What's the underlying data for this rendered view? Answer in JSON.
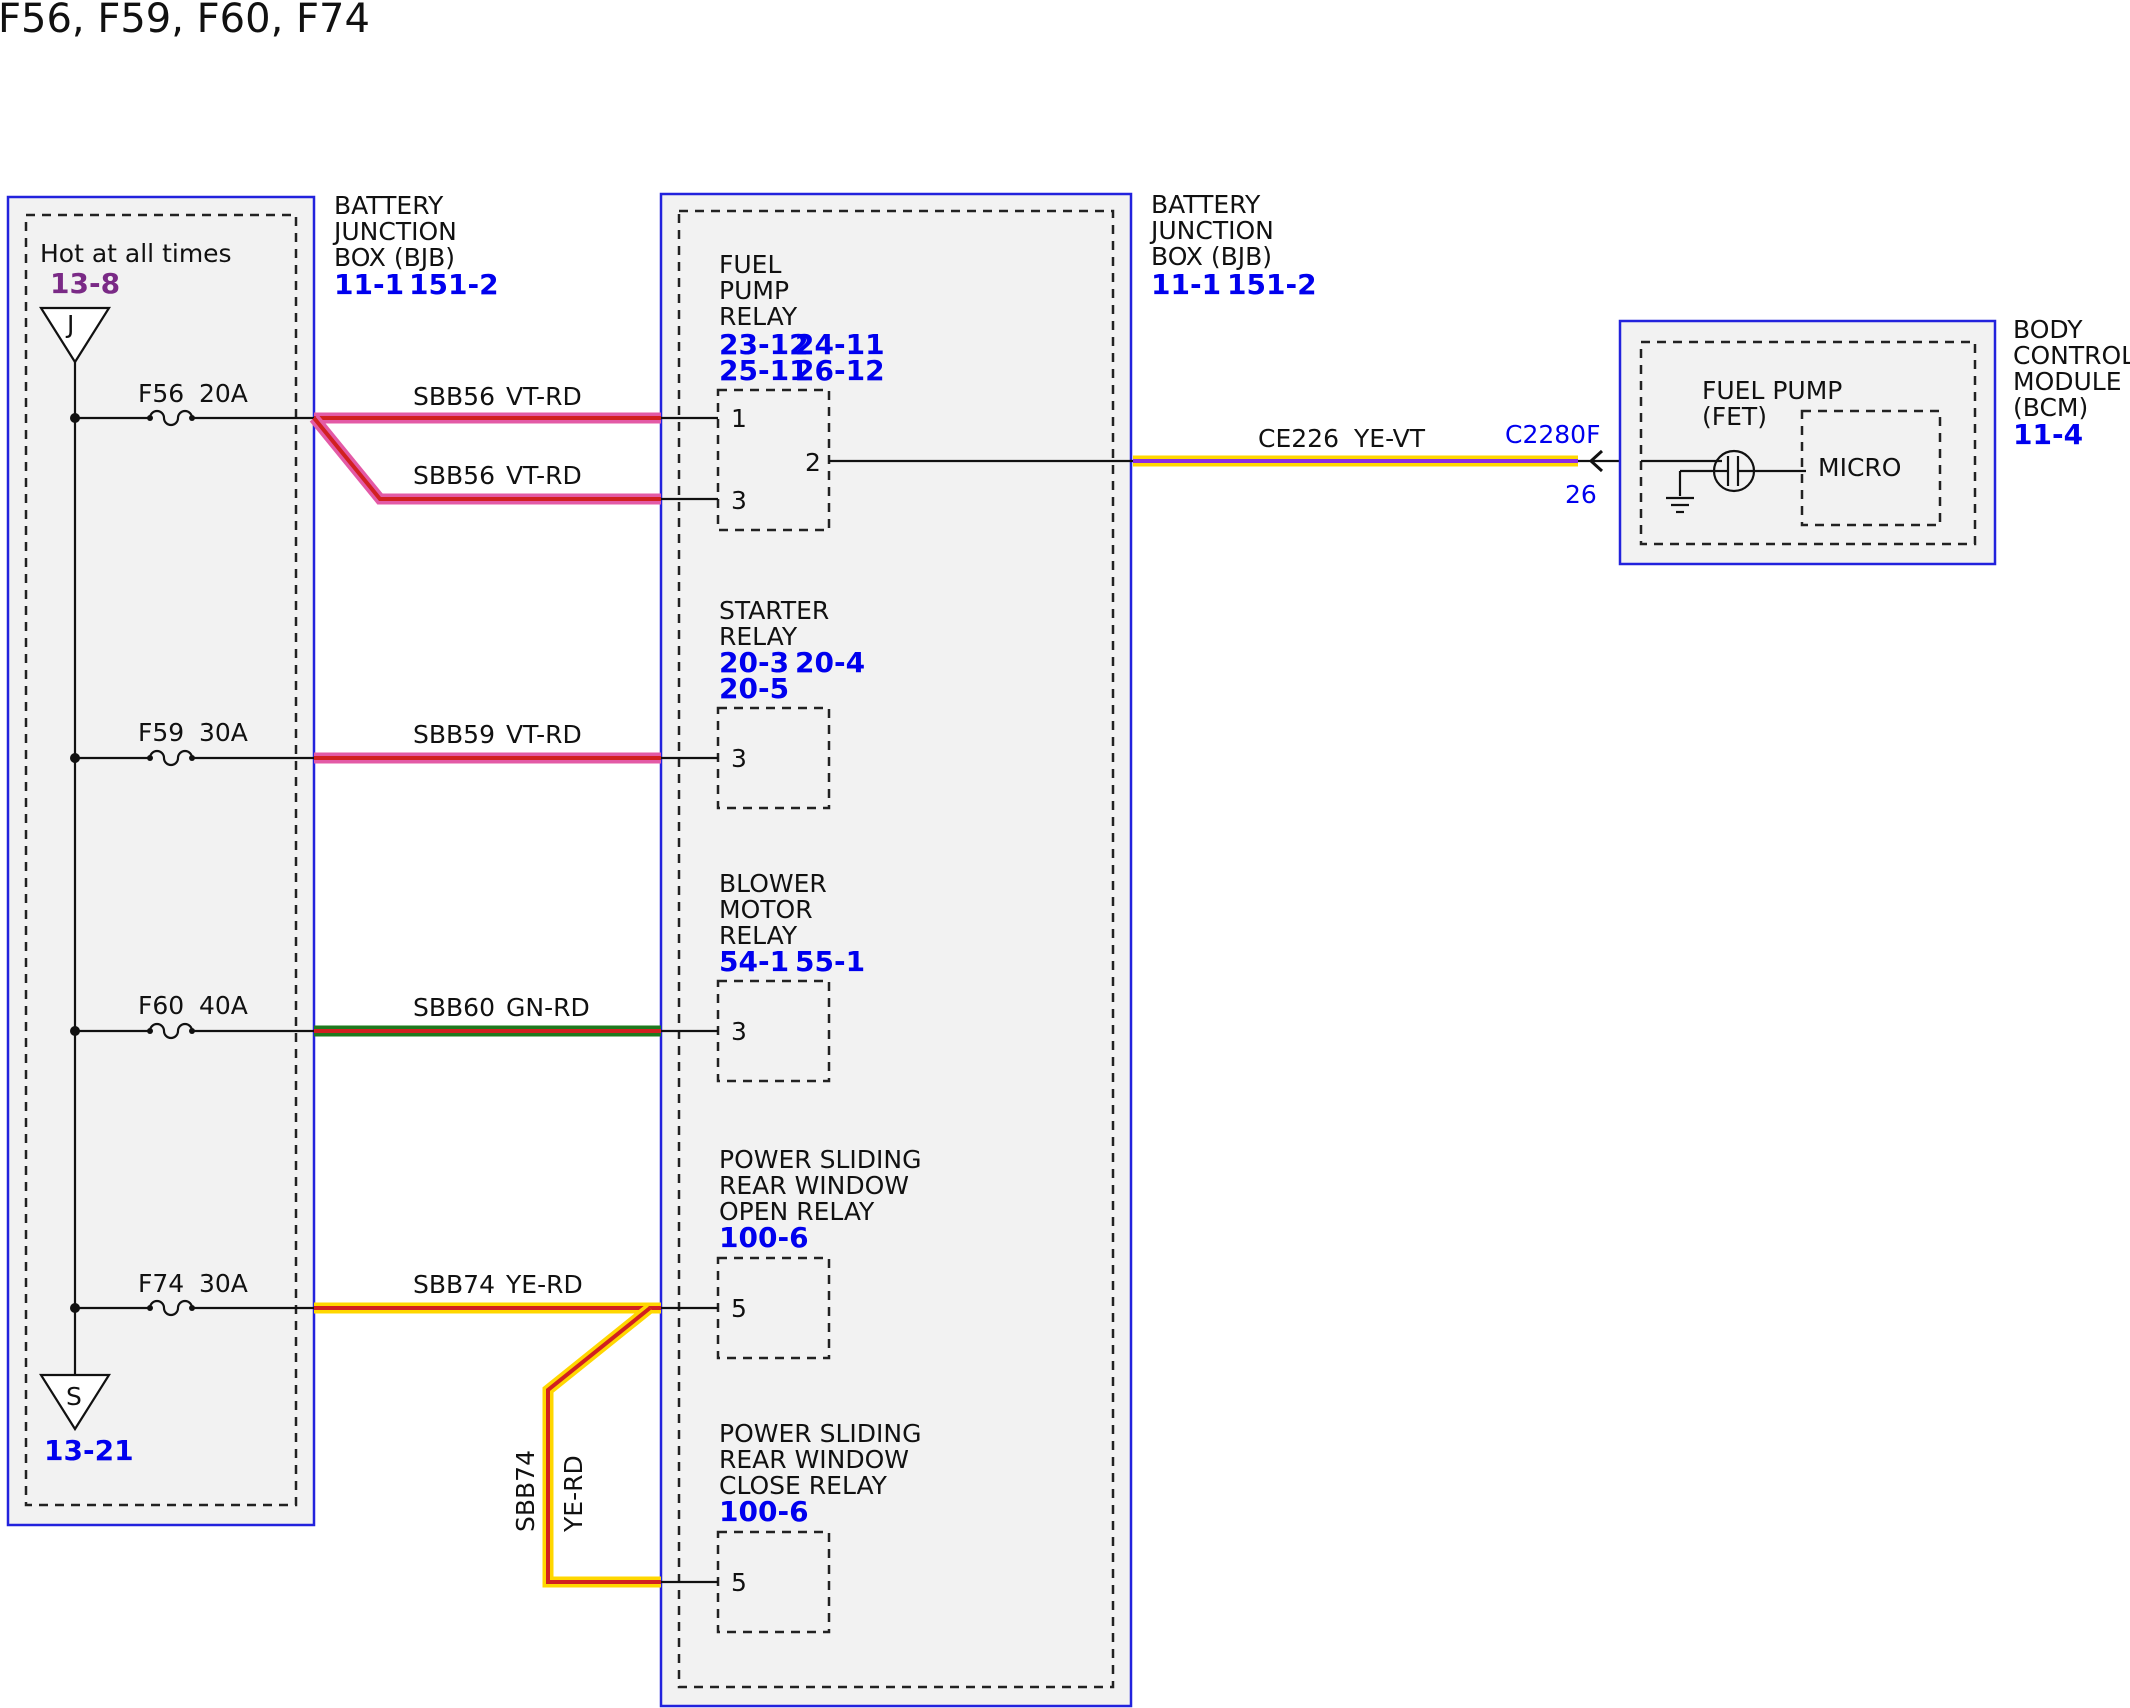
{
  "title": "F56, F59, F60, F74",
  "colors": {
    "box_border": "#2222dd",
    "ref_blue": "#0000ee",
    "ref_purple": "#7a2a86",
    "wire_vt_rd": [
      "#e35aa6",
      "#d12020"
    ],
    "wire_gn_rd": [
      "#1e7a1e",
      "#d12020"
    ],
    "wire_ye_rd": [
      "#ffd700",
      "#d12020"
    ],
    "wire_ye_vt": [
      "#ffd700",
      "#8a2be2"
    ]
  },
  "bjb_left": {
    "title": [
      "BATTERY",
      "JUNCTION",
      "BOX (BJB)"
    ],
    "refs": [
      "11-1",
      "151-2"
    ],
    "hot_label": "Hot at all times",
    "hot_ref": "13-8",
    "bus_top_letter": "J",
    "bus_bottom_letter": "S",
    "bus_bottom_ref": "13-21",
    "fuses": [
      {
        "name": "F56",
        "rating": "20A"
      },
      {
        "name": "F59",
        "rating": "30A"
      },
      {
        "name": "F60",
        "rating": "40A"
      },
      {
        "name": "F74",
        "rating": "30A"
      }
    ]
  },
  "bjb_center": {
    "title": [
      "BATTERY",
      "JUNCTION",
      "BOX (BJB)"
    ],
    "refs": [
      "11-1",
      "151-2"
    ],
    "relays": [
      {
        "name": [
          "FUEL",
          "PUMP",
          "RELAY"
        ],
        "refs": [
          "23-12",
          "24-11",
          "25-11",
          "26-12"
        ],
        "pins": [
          "1",
          "3",
          "2"
        ]
      },
      {
        "name": [
          "STARTER",
          "RELAY"
        ],
        "refs": [
          "20-3",
          "20-4",
          "20-5"
        ],
        "pins": [
          "3"
        ]
      },
      {
        "name": [
          "BLOWER",
          "MOTOR",
          "RELAY"
        ],
        "refs": [
          "54-1",
          "55-1"
        ],
        "pins": [
          "3"
        ]
      },
      {
        "name": [
          "POWER SLIDING",
          "REAR WINDOW",
          "OPEN RELAY"
        ],
        "refs": [
          "100-6"
        ],
        "pins": [
          "5"
        ]
      },
      {
        "name": [
          "POWER SLIDING",
          "REAR WINDOW",
          "CLOSE RELAY"
        ],
        "refs": [
          "100-6"
        ],
        "pins": [
          "5"
        ]
      }
    ]
  },
  "wires": [
    {
      "circuit": "SBB56",
      "color": "VT-RD"
    },
    {
      "circuit": "SBB56",
      "color": "VT-RD"
    },
    {
      "circuit": "SBB59",
      "color": "VT-RD"
    },
    {
      "circuit": "SBB60",
      "color": "GN-RD"
    },
    {
      "circuit": "SBB74",
      "color": "YE-RD"
    },
    {
      "circuit": "SBB74",
      "color": "YE-RD"
    },
    {
      "circuit": "CE226",
      "color": "YE-VT"
    }
  ],
  "connector": {
    "name": "C2280F",
    "pin": "26"
  },
  "bcm": {
    "title": [
      "BODY",
      "CONTROL",
      "MODULE",
      "(BCM)"
    ],
    "ref": "11-4",
    "fuel_pump_label": [
      "FUEL PUMP",
      "(FET)"
    ],
    "micro_label": "MICRO"
  }
}
